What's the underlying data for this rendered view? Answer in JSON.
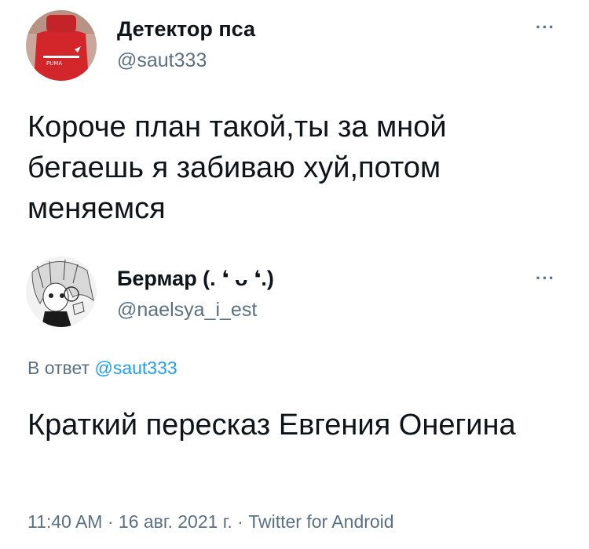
{
  "tweet1": {
    "author_name": "Детектор пса",
    "author_handle": "@saut333",
    "avatar_icon": "user-avatar-red-puma-shirt",
    "more_icon": "more-options-icon",
    "text": "Короче план такой,ты за мной бегаешь я забиваю хуй,потом меняемся"
  },
  "tweet2": {
    "author_name": "Бермар (. ❛ ᴗ ❛.)",
    "author_handle": "@naelsya_i_est",
    "avatar_icon": "user-avatar-anime-sketch",
    "more_icon": "more-options-icon",
    "reply_prefix": "В ответ",
    "reply_to": "@saut333",
    "text": "Краткий пересказ Евгения Онегина",
    "timestamp": "11:40 AM · 16 авг. 2021 г. · Twitter for Android"
  },
  "colors": {
    "primary_text": "#0f1419",
    "secondary_text": "#5b7083",
    "link": "#1da1f2"
  }
}
